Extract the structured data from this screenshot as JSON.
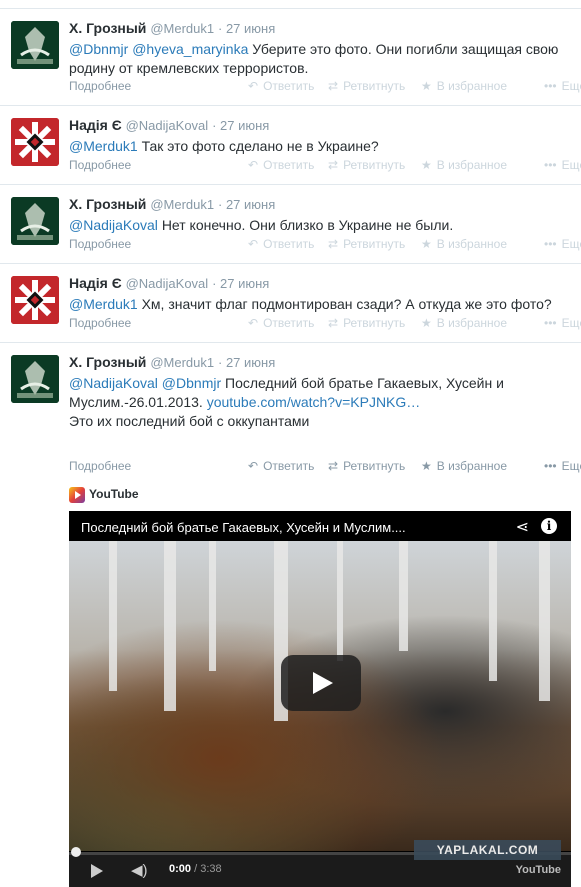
{
  "tweets": [
    {
      "fullname": "Х. Грозный",
      "username": "@Merduk1",
      "time": "27 июня",
      "avatar": "embroidered-emblem-avatar",
      "mentions": "@Dbnmjr @hyeva_maryinka",
      "text": "Уберите это фото. Они погибли защищая свою родину от кремлевских террористов."
    },
    {
      "fullname": "Надія Є",
      "username": "@NadijaKoval",
      "time": "27 июня",
      "avatar": "embroidery-pattern-avatar",
      "mentions": "@Merduk1",
      "text": "Так это фото сделано не в Украине?"
    },
    {
      "fullname": "Х. Грозный",
      "username": "@Merduk1",
      "time": "27 июня",
      "avatar": "embroidered-emblem-avatar",
      "mentions": "@NadijaKoval",
      "text": "Нет конечно. Они близко в Украине не были."
    },
    {
      "fullname": "Надія Є",
      "username": "@NadijaKoval",
      "time": "27 июня",
      "avatar": "embroidery-pattern-avatar",
      "mentions": "@Merduk1",
      "text": "Хм, значит флаг подмонтирован сзади? А откуда же это фото?"
    },
    {
      "fullname": "Х. Грозный",
      "username": "@Merduk1",
      "time": "27 июня",
      "avatar": "embroidered-emblem-avatar",
      "mentions": "@NadijaKoval @Dbnmjr",
      "text": "Последний бой братье Гакаевых, Хусейн и Муслим.-26.01.2013.",
      "link": "youtube.com/watch?v=KPJNKG…",
      "text2": "Это их последний бой с оккупантами"
    }
  ],
  "actions": {
    "more": "Подробнее",
    "reply": "Ответить",
    "retweet": "Ретвитнуть",
    "favorite": "В избранное",
    "ellipsis": "Ещё"
  },
  "card": {
    "source": "YouTube",
    "video_title": "Последний бой братье Гакаевых, Хусейн и Муслим....",
    "time_current": "0:00",
    "time_separator": " / ",
    "time_duration": "3:38",
    "progress": 0,
    "logo": "YouTube"
  },
  "watermark": "YAPLAKAL.COM",
  "colors": {
    "link": "#2b7bb9",
    "muted": "#8899a6",
    "divider": "#e1e8ed"
  }
}
